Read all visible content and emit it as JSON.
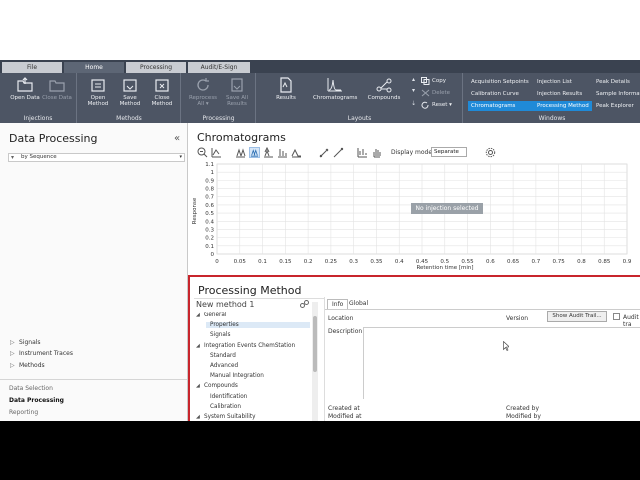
{
  "ribbon_tabs": [
    {
      "label": "File",
      "active": false
    },
    {
      "label": "Home",
      "active": true
    },
    {
      "label": "Processing",
      "active": false
    },
    {
      "label": "Audit/E-Sign",
      "active": false
    }
  ],
  "ribbon": {
    "groups": {
      "injections": "Injections",
      "methods": "Methods",
      "processing": "Processing",
      "layouts": "Layouts",
      "windows": "Windows"
    },
    "buttons": {
      "open_data": "Open Data",
      "close_data": "Close Data",
      "open_method": "Open Method",
      "save_method": "Save Method",
      "close_method": "Close Method",
      "reprocess_all": "Reprocess All ▾",
      "save_all_results": "Save All Results",
      "results": "Results",
      "chromatograms": "Chromatograms",
      "compounds": "Compounds"
    },
    "edit": {
      "copy": "Copy",
      "delete": "Delete",
      "reset": "Reset ▾"
    },
    "windows": {
      "acquisition_setpoints": "Acquisition Setpoints",
      "calibration_curve": "Calibration Curve",
      "chromatograms": "Chromatograms",
      "injection_list": "Injection List",
      "injection_results": "Injection Results",
      "processing_method": "Processing Method",
      "peak_details": "Peak Details",
      "sample_information": "Sample Informat",
      "peak_explorer": "Peak Explorer"
    }
  },
  "left_panel": {
    "title": "Data Processing",
    "collapse": "«",
    "filter": "by Sequence",
    "tree": [
      "Signals",
      "Instrument Traces",
      "Methods"
    ],
    "nav": [
      "Data Selection",
      "Data Processing",
      "Reporting"
    ]
  },
  "chromatograms": {
    "title": "Chromatograms",
    "display_mode_label": "Display mode",
    "display_mode_value": "Separate",
    "empty_message": "No injection selected"
  },
  "chart_data": {
    "type": "line",
    "xlabel": "Retention time [min]",
    "ylabel": "Response",
    "xlim": [
      0,
      0.9
    ],
    "ylim": [
      0,
      1.1
    ],
    "x_ticks": [
      "0",
      "0.05",
      "0.1",
      "0.15",
      "0.2",
      "0.25",
      "0.3",
      "0.35",
      "0.4",
      "0.45",
      "0.5",
      "0.55",
      "0.6",
      "0.65",
      "0.7",
      "0.75",
      "0.8",
      "0.85",
      "0.9"
    ],
    "y_ticks": [
      "0",
      "0.1",
      "0.2",
      "0.3",
      "0.4",
      "0.5",
      "0.6",
      "0.7",
      "0.8",
      "0.9",
      "1",
      "1.1"
    ],
    "grid": true,
    "series": []
  },
  "processing_method": {
    "title": "Processing Method",
    "name": "New method 1",
    "tree": [
      {
        "kind": "group",
        "label": "General"
      },
      {
        "kind": "item",
        "label": "Properties",
        "selected": true
      },
      {
        "kind": "item",
        "label": "Signals"
      },
      {
        "kind": "group",
        "label": "Integration Events ChemStation"
      },
      {
        "kind": "item",
        "label": "Standard"
      },
      {
        "kind": "item",
        "label": "Advanced"
      },
      {
        "kind": "item",
        "label": "Manual Integration"
      },
      {
        "kind": "group",
        "label": "Compounds"
      },
      {
        "kind": "item",
        "label": "Identification"
      },
      {
        "kind": "item",
        "label": "Calibration"
      },
      {
        "kind": "group",
        "label": "System Suitability"
      }
    ],
    "tabs": [
      {
        "label": "Info",
        "active": true
      },
      {
        "label": "Global",
        "active": false
      }
    ],
    "fields": {
      "location": "Location",
      "version": "Version",
      "description": "Description",
      "created_at": "Created at",
      "modified_at": "Modified at",
      "created_by": "Created by",
      "modified_by": "Modified by"
    },
    "show_audit_trail": "Show Audit Trail...",
    "audit_trail_check": "Audit tra"
  }
}
